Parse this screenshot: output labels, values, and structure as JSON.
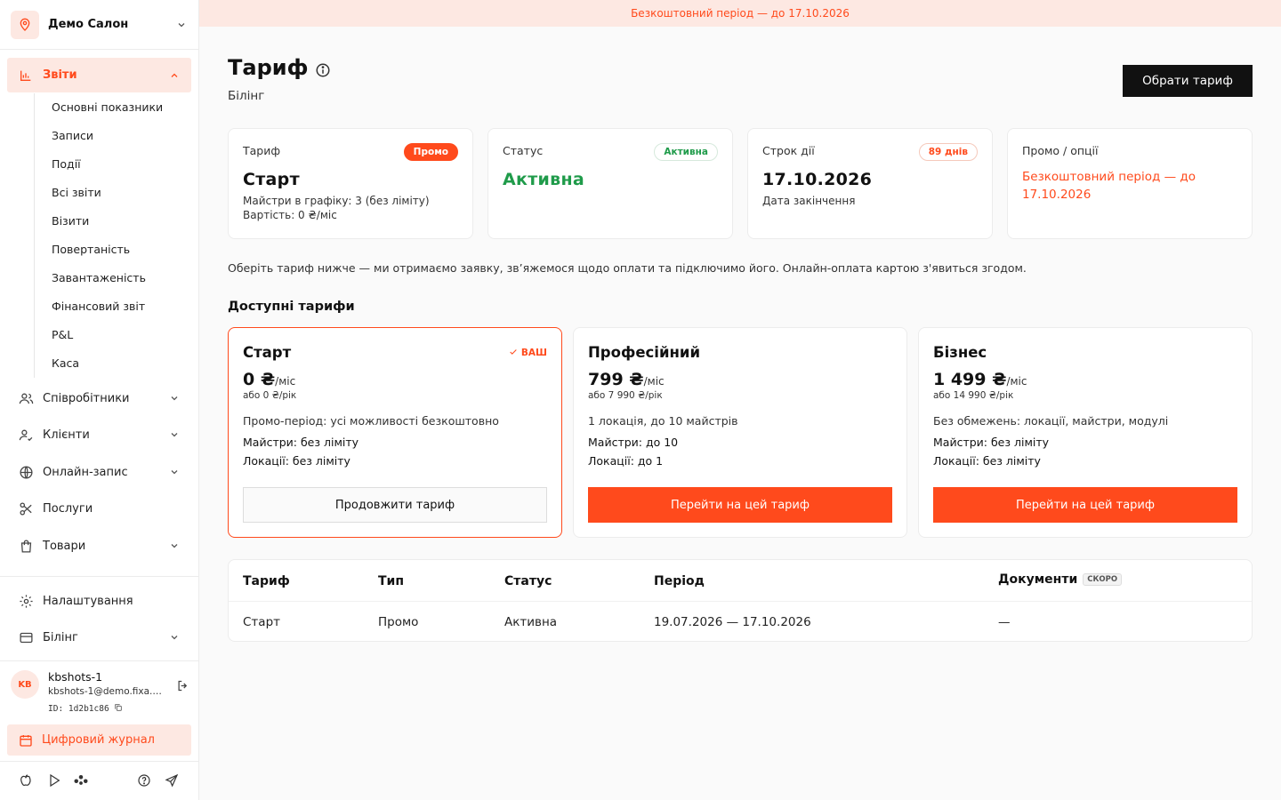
{
  "banner": {
    "text": "Безкоштовний період — до 17.10.2026"
  },
  "sidebar": {
    "salon_name": "Демо Салон",
    "active_section": "Звіти",
    "reports_items": [
      "Основні показники",
      "Записи",
      "Події",
      "Всі звіти",
      "Візити",
      "Повертаність",
      "Завантаженість",
      "Фінансовий звіт",
      "P&L",
      "Каса"
    ],
    "items": [
      {
        "label": "Співробітники",
        "icon": "users-icon"
      },
      {
        "label": "Клієнти",
        "icon": "user-check-icon"
      },
      {
        "label": "Онлайн-запис",
        "icon": "globe-icon"
      },
      {
        "label": "Послуги",
        "icon": "scissors-icon"
      },
      {
        "label": "Товари",
        "icon": "shopping-bag-icon"
      },
      {
        "label": "Налаштування",
        "icon": "gear-icon"
      },
      {
        "label": "Білінг",
        "icon": "credit-card-icon"
      }
    ],
    "user": {
      "initials": "KB",
      "name": "kbshots-1",
      "email": "kbshots-1@demo.fixa.b...",
      "id_label": "ID:",
      "id": "1d2b1c86"
    },
    "journal_label": "Цифровий журнал"
  },
  "header": {
    "title": "Тариф",
    "subtitle": "Білінг",
    "choose_button": "Обрати тариф"
  },
  "summary": {
    "tariff": {
      "label": "Тариф",
      "badge": "Промо",
      "value": "Старт",
      "line1": "Майстри в графіку: 3 (без ліміту)",
      "line2": "Вартість: 0 ₴/міс"
    },
    "status": {
      "label": "Статус",
      "badge": "Активна",
      "value": "Активна"
    },
    "term": {
      "label": "Строк дії",
      "badge": "89 днів",
      "value": "17.10.2026",
      "line1": "Дата закінчення"
    },
    "promo": {
      "label": "Промо / опції",
      "text": "Безкоштовний період — до 17.10.2026"
    }
  },
  "note": "Оберіть тариф нижче — ми отримаємо заявку, зв’яжемося щодо оплати та підключимо його. Онлайн-оплата картою з'явиться згодом.",
  "plans_title": "Доступні тарифи",
  "plans": [
    {
      "name": "Старт",
      "price": "0 ₴",
      "unit": "/міс",
      "year": "або 0 ₴/рік",
      "desc": "Промо-період: усі можливості безкоштовно",
      "masters": "Майстри: без ліміту",
      "locations": "Локації: без ліміту",
      "button": "Продовжити тариф",
      "yours": "ВАШ"
    },
    {
      "name": "Професійний",
      "price": "799 ₴",
      "unit": "/міс",
      "year": "або 7 990 ₴/рік",
      "desc": "1 локація, до 10 майстрів",
      "masters": "Майстри: до 10",
      "locations": "Локації: до 1",
      "button": "Перейти на цей тариф"
    },
    {
      "name": "Бізнес",
      "price": "1 499 ₴",
      "unit": "/міс",
      "year": "або 14 990 ₴/рік",
      "desc": "Без обмежень: локації, майстри, модулі",
      "masters": "Майстри: без ліміту",
      "locations": "Локації: без ліміту",
      "button": "Перейти на цей тариф"
    }
  ],
  "history": {
    "headers": [
      "Тариф",
      "Тип",
      "Статус",
      "Період",
      "Документи"
    ],
    "soon_badge": "СКОРО",
    "rows": [
      [
        "Старт",
        "Промо",
        "Активна",
        "19.07.2026 — 17.10.2026",
        "—"
      ]
    ]
  },
  "colors": {
    "accent": "#ff4a1c",
    "accent_light": "#fde8e2",
    "success": "#1f9b4a",
    "dark": "#111111"
  }
}
